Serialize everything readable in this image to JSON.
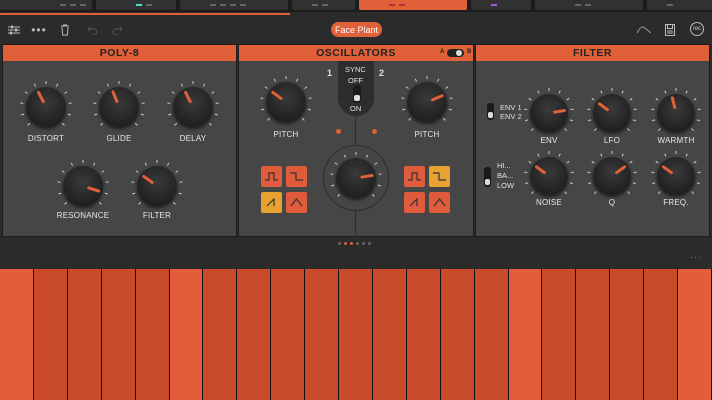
{
  "toolbar": {
    "preset_name": "Face Plant",
    "rec_label": "rec"
  },
  "poly8": {
    "title": "POLY-8",
    "knobs": [
      {
        "label": "DISTORT",
        "value": 0.4
      },
      {
        "label": "GLIDE",
        "value": 0.42
      },
      {
        "label": "DELAY",
        "value": 0.4
      },
      {
        "label": "RESONANCE",
        "value": 0.9
      },
      {
        "label": "FILTER",
        "value": 0.3
      }
    ]
  },
  "oscillators": {
    "title": "OSCILLATORS",
    "toggle_a": "A",
    "toggle_b": "B",
    "osc1_number": "1",
    "osc2_number": "2",
    "sync_label": "SYNC",
    "sync_off": "OFF",
    "sync_on": "ON",
    "osc1_pitch_label": "PITCH",
    "osc2_pitch_label": "PITCH",
    "osc1_pitch": 0.3,
    "osc2_pitch": 0.75,
    "mix": 0.8
  },
  "filter": {
    "title": "FILTER",
    "env_options": [
      "ENV 1",
      "ENV 2"
    ],
    "type_options": [
      "HI...",
      "BA...",
      "LOW"
    ],
    "knobs": [
      {
        "label": "ENV",
        "value": 0.8
      },
      {
        "label": "LFO",
        "value": 0.3
      },
      {
        "label": "WARMTH",
        "value": 0.45
      },
      {
        "label": "NOISE",
        "value": 0.3
      },
      {
        "label": "Q",
        "value": 0.7
      },
      {
        "label": "FREQ.",
        "value": 0.3
      }
    ]
  },
  "pager": {
    "pages": 6,
    "active": 1
  },
  "colors": {
    "accent": "#e0603a",
    "panel": "#464647",
    "yellow": "#e8a231"
  },
  "icons": [
    "sliders-icon",
    "more-icon",
    "trash-icon",
    "undo-icon",
    "redo-icon",
    "envelope-curve-icon",
    "save-icon",
    "record-icon"
  ]
}
